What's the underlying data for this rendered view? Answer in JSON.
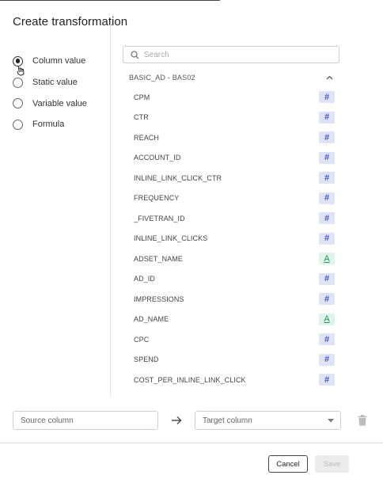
{
  "dialog": {
    "title": "Create transformation"
  },
  "modes": [
    {
      "label": "Column value",
      "checked": true
    },
    {
      "label": "Static value",
      "checked": false
    },
    {
      "label": "Variable value",
      "checked": false
    },
    {
      "label": "Formula",
      "checked": false
    }
  ],
  "search": {
    "placeholder": "Search",
    "value": ""
  },
  "group": {
    "title": "BASIC_AD - BAS02",
    "expanded": true
  },
  "columns": [
    {
      "name": "CPM",
      "type": "number",
      "badge": "#"
    },
    {
      "name": "CTR",
      "type": "number",
      "badge": "#"
    },
    {
      "name": "REACH",
      "type": "number",
      "badge": "#"
    },
    {
      "name": "ACCOUNT_ID",
      "type": "number",
      "badge": "#"
    },
    {
      "name": "INLINE_LINK_CLICK_CTR",
      "type": "number",
      "badge": "#"
    },
    {
      "name": "FREQUENCY",
      "type": "number",
      "badge": "#"
    },
    {
      "name": "_FIVETRAN_ID",
      "type": "number",
      "badge": "#"
    },
    {
      "name": "INLINE_LINK_CLICKS",
      "type": "number",
      "badge": "#"
    },
    {
      "name": "ADSET_NAME",
      "type": "text",
      "badge": "A"
    },
    {
      "name": "AD_ID",
      "type": "number",
      "badge": "#"
    },
    {
      "name": "IMPRESSIONS",
      "type": "number",
      "badge": "#"
    },
    {
      "name": "AD_NAME",
      "type": "text",
      "badge": "A"
    },
    {
      "name": "CPC",
      "type": "number",
      "badge": "#"
    },
    {
      "name": "SPEND",
      "type": "number",
      "badge": "#"
    },
    {
      "name": "COST_PER_INLINE_LINK_CLICK",
      "type": "number",
      "badge": "#"
    }
  ],
  "mapping": {
    "source_placeholder": "Source column",
    "source_value": "",
    "target_placeholder": "Target column"
  },
  "footer": {
    "cancel_label": "Cancel",
    "save_label": "Save",
    "save_enabled": false
  },
  "colors": {
    "number_badge_bg": "#dfe3f7",
    "number_badge_fg": "#4757b5",
    "text_badge_bg": "#dff5ea",
    "text_badge_fg": "#2e8f5d"
  },
  "icons": {
    "search": "search-icon",
    "group_toggle": "chevron-up-icon",
    "arrow": "arrow-right-icon",
    "select": "caret-down-icon",
    "delete": "trash-icon",
    "cursor": "mouse-cursor-icon"
  }
}
